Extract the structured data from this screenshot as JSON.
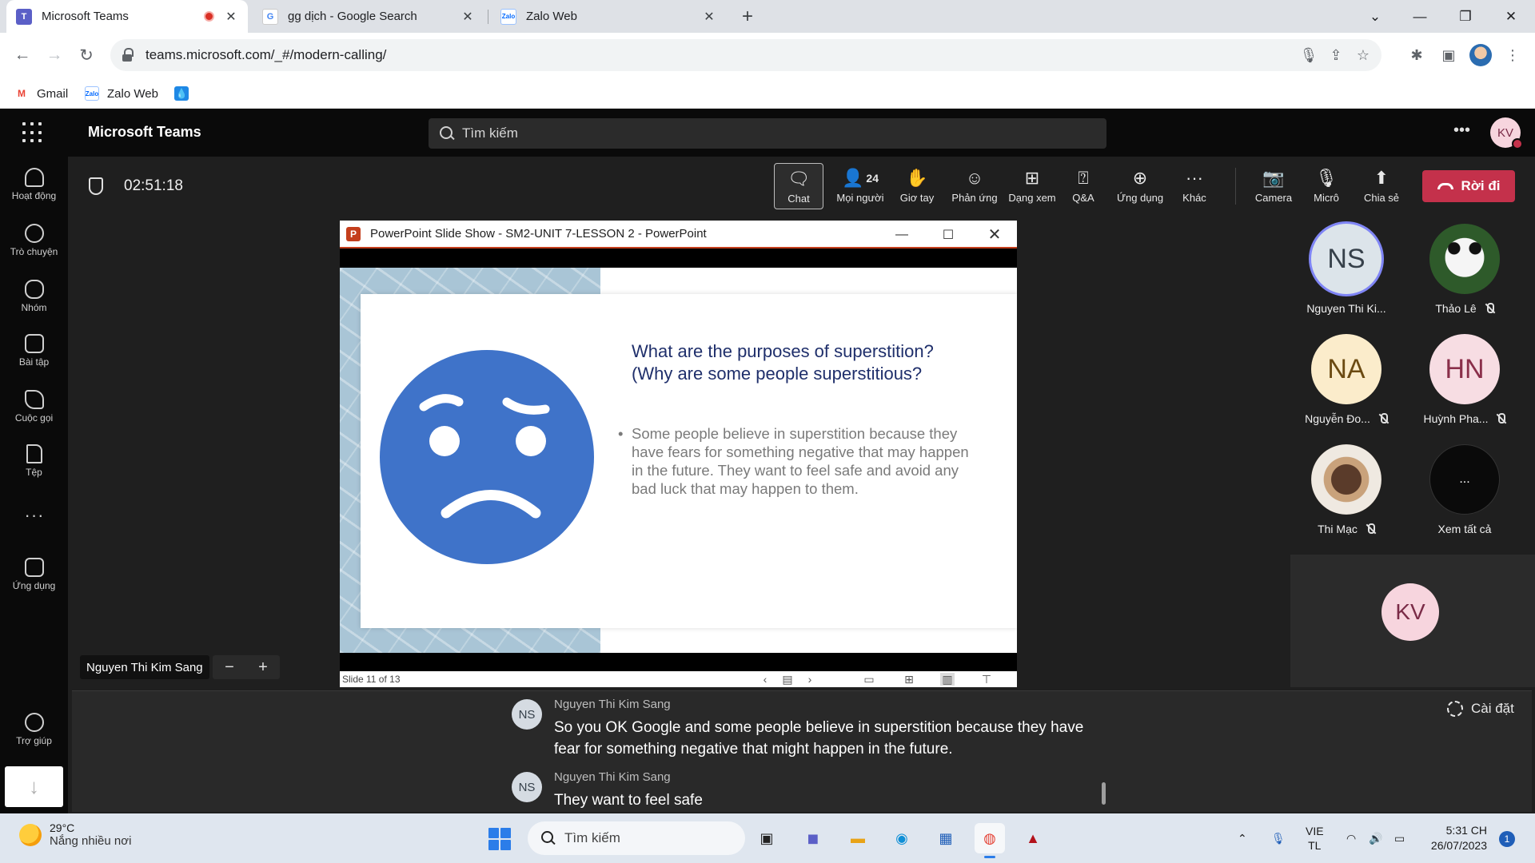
{
  "browser": {
    "tabs": [
      {
        "title": "Microsoft Teams",
        "favicon": "teams-icon",
        "recording": true,
        "active": true
      },
      {
        "title": "gg dịch - Google Search",
        "favicon": "google-icon",
        "active": false
      },
      {
        "title": "Zalo Web",
        "favicon": "zalo-icon",
        "active": false
      }
    ],
    "url": "teams.microsoft.com/_#/modern-calling/",
    "bookmarks": [
      {
        "label": "Gmail",
        "icon": "gmail-icon"
      },
      {
        "label": "Zalo Web",
        "icon": "zalo-icon"
      },
      {
        "label": "",
        "icon": "drop-icon"
      }
    ]
  },
  "teams": {
    "app_title": "Microsoft Teams",
    "search_placeholder": "Tìm kiếm",
    "user_initials": "KV",
    "rail": [
      {
        "label": "Hoạt động",
        "icon": "bell-icon"
      },
      {
        "label": "Trò chuyện",
        "icon": "chat-icon"
      },
      {
        "label": "Nhóm",
        "icon": "teams-group-icon"
      },
      {
        "label": "Bài tập",
        "icon": "assignments-icon"
      },
      {
        "label": "Cuộc gọi",
        "icon": "phone-icon"
      },
      {
        "label": "Tệp",
        "icon": "file-icon"
      },
      {
        "label": "",
        "icon": "more-icon"
      },
      {
        "label": "Ứng dụng",
        "icon": "apps-icon"
      },
      {
        "label": "Trợ giúp",
        "icon": "help-icon"
      }
    ]
  },
  "meeting": {
    "timer": "02:51:18",
    "controls": [
      {
        "label": "Chat",
        "icon": "chat-icon",
        "active": true
      },
      {
        "label": "Mọi người",
        "icon": "people-icon",
        "count": "24"
      },
      {
        "label": "Giơ tay",
        "icon": "raise-hand-icon"
      },
      {
        "label": "Phản ứng",
        "icon": "smile-icon"
      },
      {
        "label": "Dạng xem",
        "icon": "view-grid-icon"
      },
      {
        "label": "Q&A",
        "icon": "qa-icon"
      },
      {
        "label": "Ứng dụng",
        "icon": "add-app-icon"
      },
      {
        "label": "Khác",
        "icon": "more-icon"
      },
      {
        "label": "Camera",
        "icon": "camera-off-icon"
      },
      {
        "label": "Micrô",
        "icon": "mic-off-icon"
      },
      {
        "label": "Chia sẻ",
        "icon": "share-icon"
      }
    ],
    "leave_label": "Rời đi",
    "presenter_name": "Nguyen Thi Kim Sang"
  },
  "powerpoint": {
    "window_title": "PowerPoint Slide Show  -  SM2-UNIT 7-LESSON 2 - PowerPoint",
    "slide_heading_line1": "What are the purposes of superstition?",
    "slide_heading_line2": "(Why are some people superstitious?",
    "slide_bullet": "Some people believe in superstition because they have fears for something negative that may happen in the future. They want to feel safe and avoid any bad luck that may happen to them.",
    "slide_status": "Slide 11 of 13"
  },
  "participants": [
    {
      "initials": "NS",
      "name": "Nguyen Thi Ki...",
      "bg": "#dce4ea",
      "fg": "#36404a",
      "muted": false,
      "speaking": true,
      "photo": false
    },
    {
      "initials": "",
      "name": "Thảo Lê",
      "bg": "#e8e8e8",
      "fg": "#222",
      "muted": true,
      "speaking": false,
      "photo": "panda"
    },
    {
      "initials": "NA",
      "name": "Nguyễn Đo...",
      "bg": "#fbeccb",
      "fg": "#6b4a12",
      "muted": true,
      "speaking": false,
      "photo": false
    },
    {
      "initials": "HN",
      "name": "Huỳnh Pha...",
      "bg": "#f7dde3",
      "fg": "#8a2f4a",
      "muted": true,
      "speaking": false,
      "photo": false
    },
    {
      "initials": "",
      "name": "Thi Mạc",
      "bg": "#7a6a5a",
      "fg": "#fff",
      "muted": true,
      "speaking": false,
      "photo": "food"
    },
    {
      "initials": "...",
      "name": "Xem tất cả",
      "bg": "#0a0a0a",
      "fg": "#fff",
      "muted": false,
      "speaking": false,
      "photo": false
    }
  ],
  "self_tile": {
    "initials": "KV"
  },
  "captions": {
    "settings_label": "Cài đặt",
    "entries": [
      {
        "initials": "NS",
        "speaker": "Nguyen Thi Kim Sang",
        "text": "So you OK Google and some people believe in superstition because they have fear for something negative that might happen in the future."
      },
      {
        "initials": "NS",
        "speaker": "Nguyen Thi Kim Sang",
        "text": "They want to feel safe"
      }
    ]
  },
  "taskbar": {
    "weather_temp": "29°C",
    "weather_desc": "Nắng nhiều nơi",
    "search_label": "Tìm kiếm",
    "lang_line1": "VIE",
    "lang_line2": "TL",
    "time": "5:31 CH",
    "date": "26/07/2023",
    "notification_count": "1"
  }
}
